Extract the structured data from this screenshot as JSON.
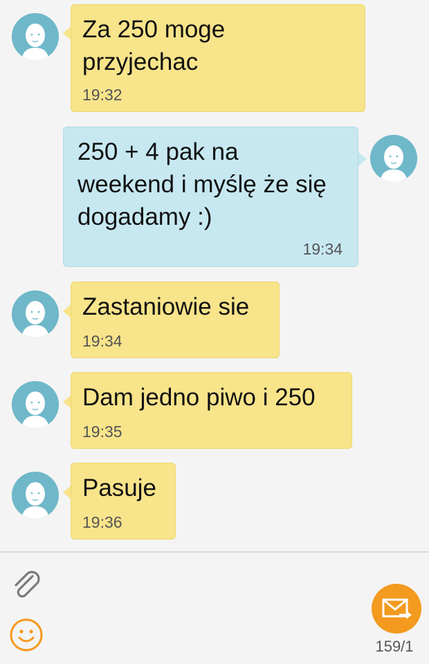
{
  "messages": [
    {
      "direction": "incoming",
      "text": "Za 250 moge\nprzyjechac",
      "time": "19:32"
    },
    {
      "direction": "outgoing",
      "text": "250 + 4 pak na\nweekend i myślę że się\ndogadamy :)",
      "time": "19:34"
    },
    {
      "direction": "incoming",
      "text": "Zastaniowie sie",
      "time": "19:34"
    },
    {
      "direction": "incoming",
      "text": "Dam jedno piwo i 250",
      "time": "19:35"
    },
    {
      "direction": "incoming",
      "text": "Pasuje",
      "time": "19:36"
    }
  ],
  "composer": {
    "attach_icon": "paperclip-icon",
    "emoji_icon": "smiley-icon",
    "send_icon": "send-message-icon",
    "counter": "159/1"
  },
  "colors": {
    "incoming_bubble": "#f8e48a",
    "outgoing_bubble": "#c7e8f1",
    "avatar": "#6fb8c9",
    "send_button": "#f39a1f",
    "background": "#f4f4f4"
  }
}
